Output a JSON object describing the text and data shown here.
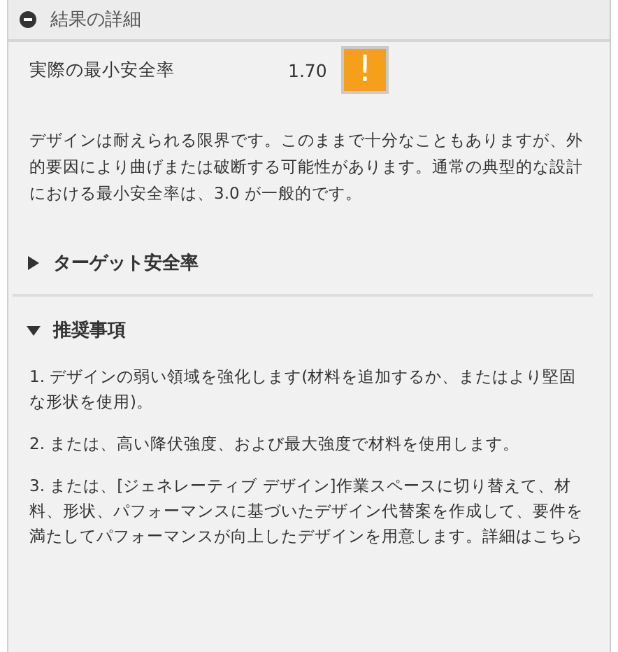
{
  "panel": {
    "title": "結果の詳細",
    "expanded": true
  },
  "metric": {
    "label": "実際の最小安全率",
    "value": "1.70",
    "status_glyph": "!"
  },
  "description": "デザインは耐えられる限界です。このままで十分なこともありますが、外的要因により曲げまたは破断する可能性があります。通常の典型的な設計における最小安全率は、3.0 が一般的です。",
  "sections": [
    {
      "title": "ターゲット安全率",
      "expanded": false
    },
    {
      "title": "推奨事項",
      "expanded": true,
      "items": [
        "1. デザインの弱い領域を強化します(材料を追加するか、またはより堅固な形状を使用)。",
        "2. または、高い降伏強度、および最大強度で材料を使用します。",
        "3. または、[ジェネレーティブ デザイン]作業スペースに切り替えて、材料、形状、パフォーマンスに基づいたデザイン代替案を作成して、要件を満たしてパフォーマンスが向上したデザインを用意します。詳細はこちら"
      ]
    }
  ]
}
